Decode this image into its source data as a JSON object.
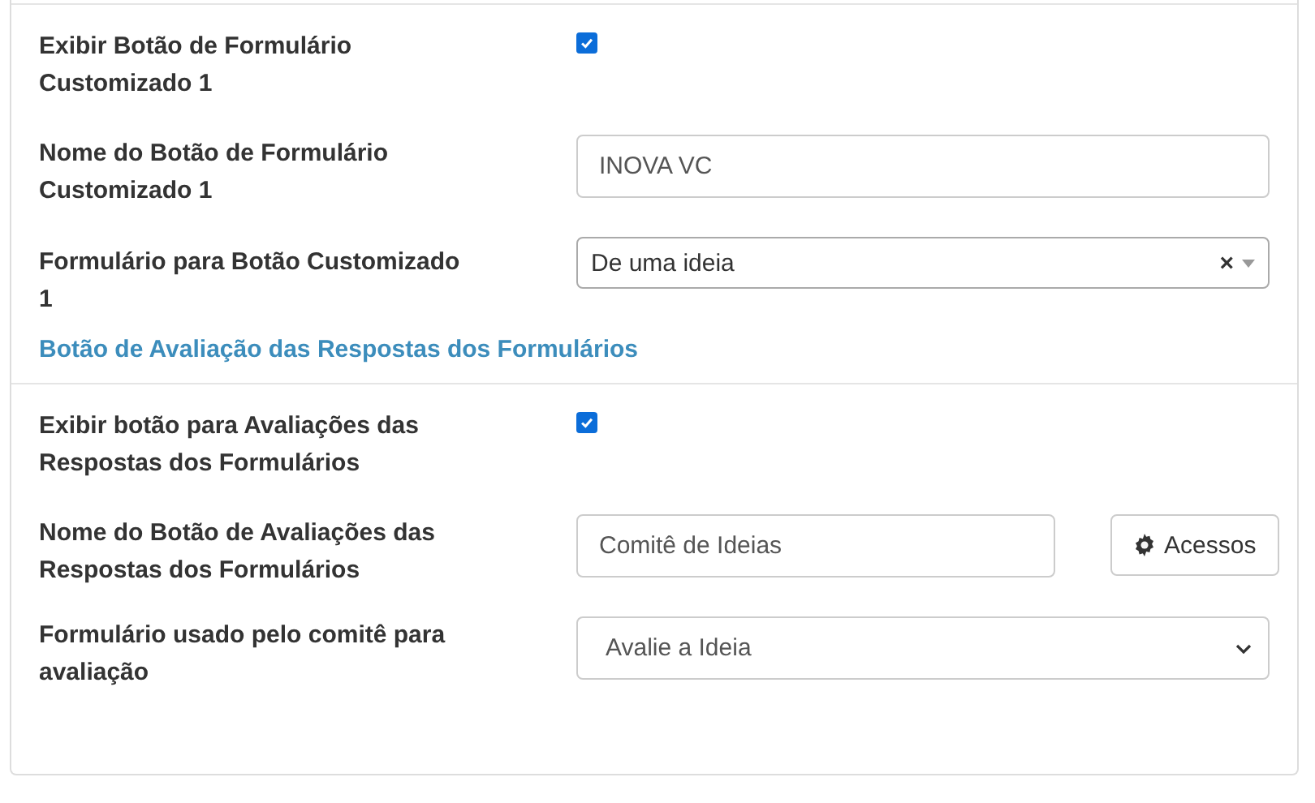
{
  "sections": [
    {
      "fields": [
        {
          "kind": "checkbox",
          "label": "Exibir Botão de Formulário Customizado 1",
          "checked": true
        },
        {
          "kind": "text",
          "label": "Nome do Botão de Formulário Customizado 1",
          "value": "INOVA VC"
        },
        {
          "kind": "combo",
          "label": "Formulário para Botão Customizado 1",
          "value": "De uma ideia",
          "clear": "×"
        }
      ]
    },
    {
      "heading": "Botão de Avaliação das Respostas dos Formulários",
      "fields": [
        {
          "kind": "checkbox",
          "label": "Exibir botão para Avaliações das Respostas dos Formulários",
          "checked": true
        },
        {
          "kind": "text",
          "label": "Nome do Botão de Avaliações das Respostas dos Formulários",
          "value": "Comitê de Ideias",
          "button": "Acessos"
        },
        {
          "kind": "select",
          "label": "Formulário usado pelo comitê para avaliação",
          "value": "Avalie a Ideia"
        }
      ]
    }
  ]
}
